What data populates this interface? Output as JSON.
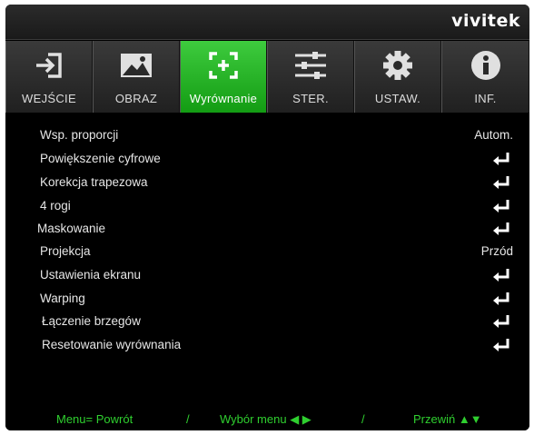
{
  "brand": "vivitek",
  "tabs": [
    {
      "label": "WEJŚCIE",
      "icon": "input-icon"
    },
    {
      "label": "OBRAZ",
      "icon": "image-icon"
    },
    {
      "label": "Wyrównanie",
      "icon": "alignment-icon"
    },
    {
      "label": "STER.",
      "icon": "sliders-icon"
    },
    {
      "label": "USTAW.",
      "icon": "gear-icon"
    },
    {
      "label": "INF.",
      "icon": "info-icon"
    }
  ],
  "active_tab": "Wyrównanie",
  "menu": [
    {
      "label": "Wsp. proporcji",
      "value": "Autom."
    },
    {
      "label": "Powiększenie cyfrowe",
      "value": "",
      "icon": "enter-icon"
    },
    {
      "label": "Korekcja trapezowa",
      "value": "",
      "icon": "enter-icon"
    },
    {
      "label": "4 rogi",
      "value": "",
      "icon": "enter-icon"
    },
    {
      "label": "Maskowanie",
      "value": "",
      "icon": "enter-icon"
    },
    {
      "label": "Projekcja",
      "value": "Przód"
    },
    {
      "label": "Ustawienia ekranu",
      "value": "",
      "icon": "enter-icon"
    },
    {
      "label": "Warping",
      "value": "",
      "icon": "enter-icon"
    },
    {
      "label": "Łączenie brzegów",
      "value": "",
      "icon": "enter-icon"
    },
    {
      "label": "Resetowanie wyrównania",
      "value": "",
      "icon": "enter-icon"
    }
  ],
  "footer": {
    "back": "Menu= Powrót",
    "sep1": "/",
    "select": "Wybór menu ◀ ▶",
    "sep2": "/",
    "scroll": "Przewiń ▲▼"
  },
  "colors": {
    "accent": "#22b422",
    "footer_text": "#2fcf2f",
    "background": "#000000"
  }
}
